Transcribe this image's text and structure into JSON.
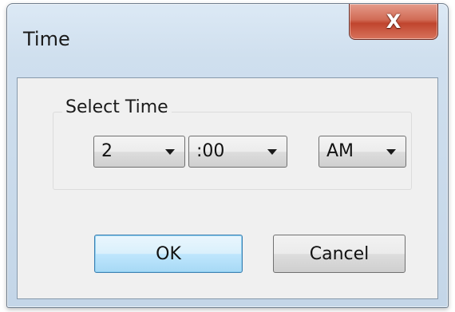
{
  "window": {
    "title": "Time",
    "close_symbol": "X"
  },
  "group": {
    "label": "Select Time"
  },
  "hour_select": {
    "value": "2",
    "icon": "chevron-down-icon"
  },
  "minute_select": {
    "value": ":00",
    "icon": "chevron-down-icon"
  },
  "ampm_select": {
    "value": "AM",
    "icon": "chevron-down-icon"
  },
  "buttons": {
    "ok_label": "OK",
    "cancel_label": "Cancel"
  },
  "colors": {
    "ok_button_accent": "#a7d9f5",
    "close_button": "#c0452e",
    "frame": "#c4d6e8"
  }
}
